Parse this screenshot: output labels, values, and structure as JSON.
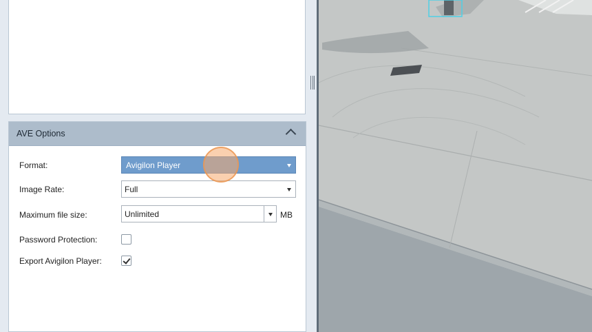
{
  "ave_options": {
    "title": "AVE Options",
    "format": {
      "label": "Format:",
      "value": "Avigilon Player"
    },
    "image_rate": {
      "label": "Image Rate:",
      "value": "Full"
    },
    "max_file_size": {
      "label": "Maximum file size:",
      "value": "Unlimited",
      "unit": "MB"
    },
    "password_protection": {
      "label": "Password Protection:",
      "checked": false
    },
    "export_player": {
      "label": "Export Avigilon Player:",
      "checked": true
    }
  },
  "colors": {
    "header_bg": "#adbccb",
    "selected_bg": "#6f9ccc",
    "click_indicator": "#f5aa6e"
  }
}
